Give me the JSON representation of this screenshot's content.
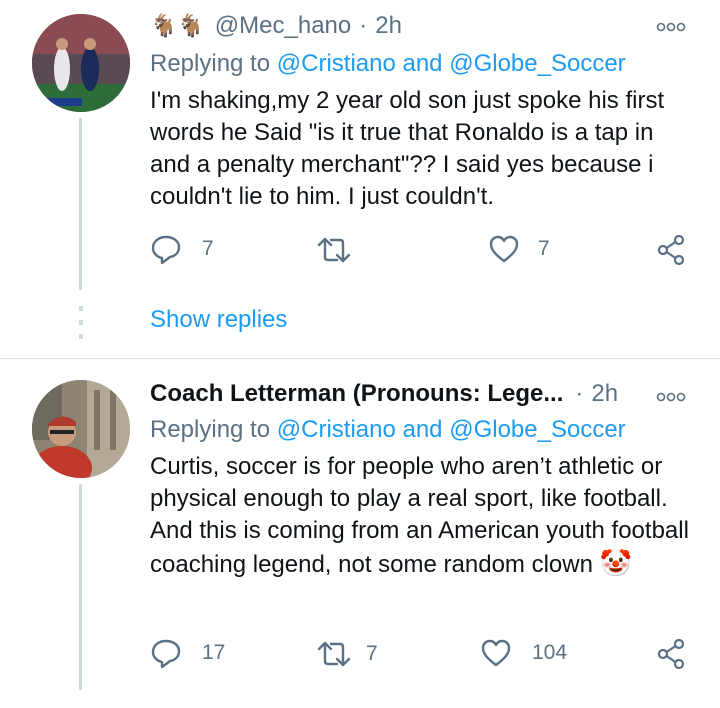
{
  "tweets": [
    {
      "display_name_emoji": "🐐🐐",
      "handle": "@Mec_hano",
      "separator": "·",
      "time": "2h",
      "replying_prefix": "Replying to",
      "mention_1": "@Cristiano",
      "and": "and",
      "mention_2": "@Globe_Soccer",
      "body": "I'm shaking,my 2 year old son just spoke his first words he Said \"is it true that Ronaldo is a tap in and a penalty merchant\"?? I said yes because i couldn't lie to him. I just couldn't.",
      "reply_count": "7",
      "retweet_count": "",
      "like_count": "7"
    },
    {
      "display_name": "Coach Letterman (Pronouns: Lege...",
      "separator": "·",
      "time": "2h",
      "replying_prefix": "Replying to",
      "mention_1": "@Cristiano",
      "and": "and",
      "mention_2": "@Globe_Soccer",
      "body": "Curtis, soccer is for people who aren’t athletic or physical enough to play a real sport, like football. And this is coming from an American youth football coaching legend, not some random clown",
      "body_emoji": "🤡",
      "reply_count": "17",
      "retweet_count": "7",
      "like_count": "104"
    }
  ],
  "show_replies": "Show replies",
  "icons": {
    "reply": "reply-icon",
    "retweet": "retweet-icon",
    "like": "heart-icon",
    "share": "share-icon",
    "more": "more-options-icon"
  },
  "colors": {
    "link": "#1d9bf0",
    "secondary_text": "#5b7083",
    "thread_line": "#cfd9de"
  }
}
